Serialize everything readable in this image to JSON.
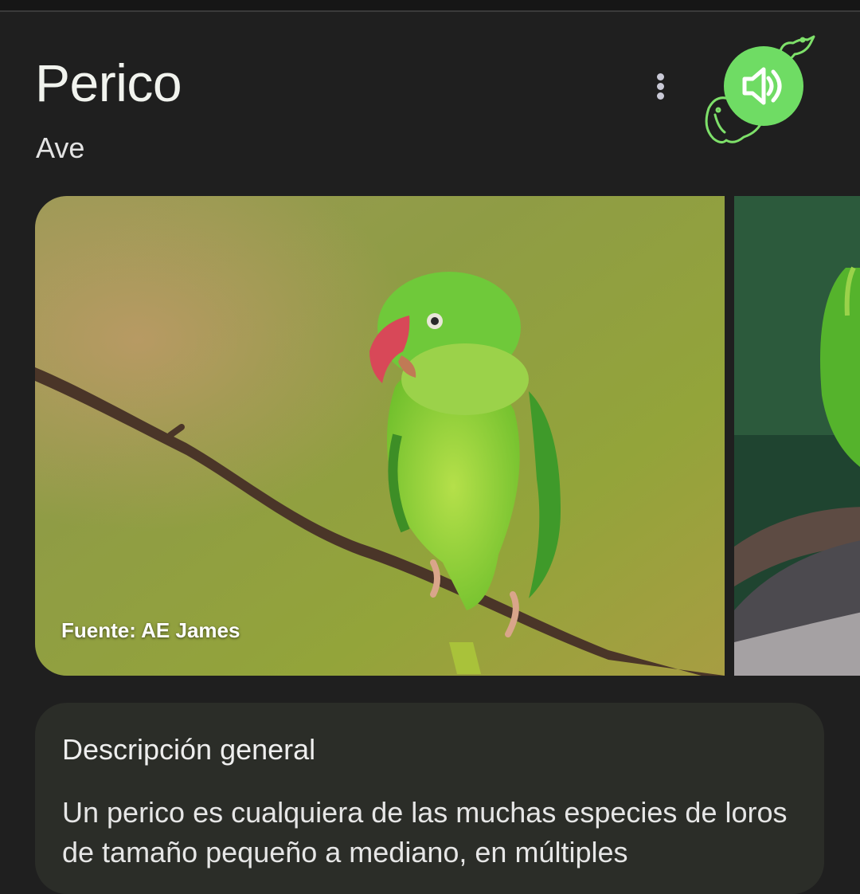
{
  "header": {
    "title": "Perico",
    "subtitle": "Ave"
  },
  "actions": {
    "more_icon": "more-vert-icon",
    "speaker_icon": "volume-up-icon",
    "speaker_color": "#6fdc64"
  },
  "gallery": {
    "main_credit": "Fuente: AE James"
  },
  "overview": {
    "heading": "Descripción general",
    "text": "Un perico es cualquiera de las muchas especies de loros de tamaño pequeño a mediano, en múltiples"
  }
}
